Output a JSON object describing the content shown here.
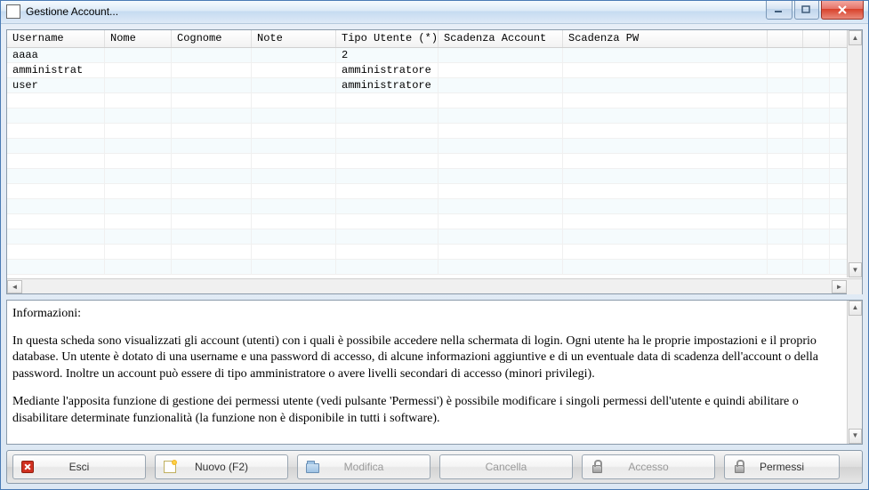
{
  "window": {
    "title": "Gestione Account..."
  },
  "grid": {
    "columns": [
      "Username",
      "Nome",
      "Cognome",
      "Note",
      "Tipo Utente (*)",
      "Scadenza Account",
      "Scadenza PW"
    ],
    "rows": [
      {
        "username": "aaaa",
        "nome": "",
        "cognome": "",
        "note": "",
        "tipo": "2",
        "scad_acc": "",
        "scad_pw": ""
      },
      {
        "username": "amministrat",
        "nome": "",
        "cognome": "",
        "note": "",
        "tipo": "amministratore",
        "scad_acc": "",
        "scad_pw": ""
      },
      {
        "username": "user",
        "nome": "",
        "cognome": "",
        "note": "",
        "tipo": "amministratore",
        "scad_acc": "",
        "scad_pw": ""
      }
    ]
  },
  "info": {
    "title": "Informazioni:",
    "p1": "In questa scheda sono visualizzati gli account (utenti) con i quali è possibile accedere nella schermata di login. Ogni utente ha le proprie impostazioni e il proprio database. Un utente è dotato di una username e una password di accesso, di alcune informazioni aggiuntive e di un eventuale data di scadenza dell'account o della password. Inoltre un account può essere di tipo amministratore o avere livelli secondari di accesso (minori privilegi).",
    "p2": "Mediante l'apposita funzione di gestione dei permessi utente (vedi pulsante 'Permessi') è possibile modificare i singoli permessi dell'utente e quindi abilitare o disabilitare determinate funzionalità (la funzione non è disponibile in tutti i software)."
  },
  "toolbar": {
    "esci": "Esci",
    "nuovo": "Nuovo (F2)",
    "modifica": "Modifica",
    "cancella": "Cancella",
    "accesso": "Accesso",
    "permessi": "Permessi"
  }
}
